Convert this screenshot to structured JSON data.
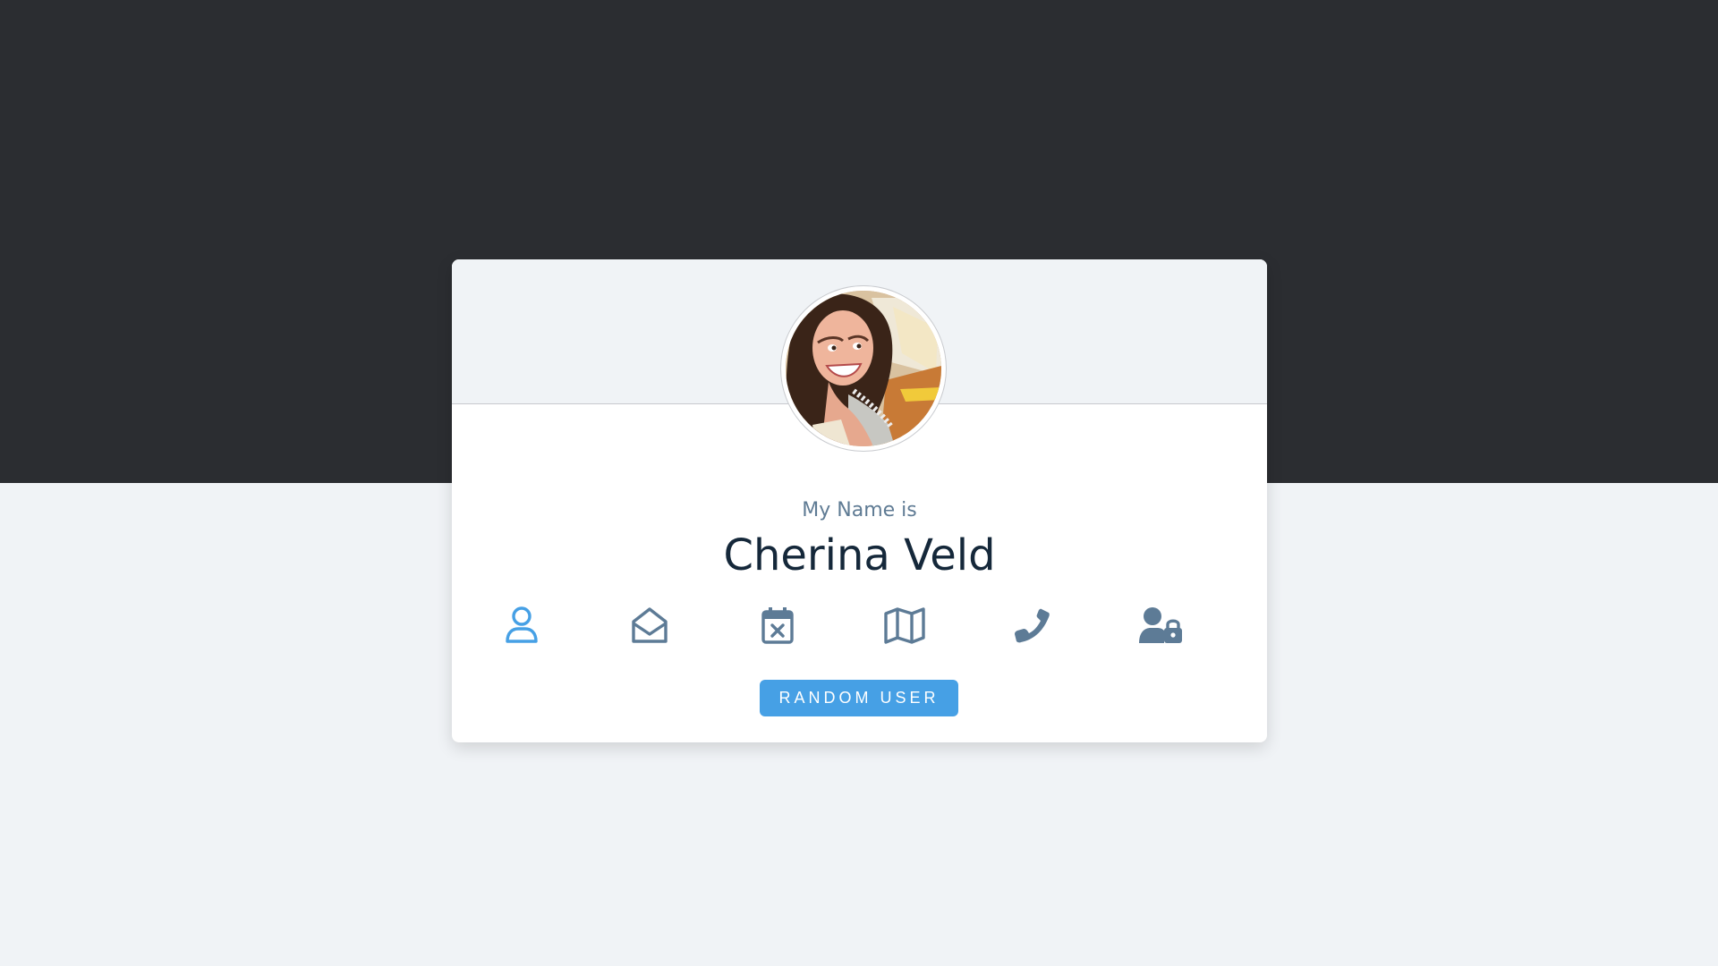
{
  "profile": {
    "title": "My Name is",
    "value": "Cherina Veld"
  },
  "icons": [
    {
      "name": "user-icon",
      "active": true
    },
    {
      "name": "envelope-open-icon",
      "active": false
    },
    {
      "name": "calendar-x-icon",
      "active": false
    },
    {
      "name": "map-icon",
      "active": false
    },
    {
      "name": "phone-icon",
      "active": false
    },
    {
      "name": "user-lock-icon",
      "active": false
    }
  ],
  "button": {
    "label": "RANDOM USER"
  },
  "colors": {
    "dark_band": "#2b2d31",
    "light_background": "#f0f3f6",
    "active_icon": "#46a0e5",
    "inactive_icon": "#5d7b96",
    "button": "#46a0e5",
    "name_text": "#15283a"
  }
}
